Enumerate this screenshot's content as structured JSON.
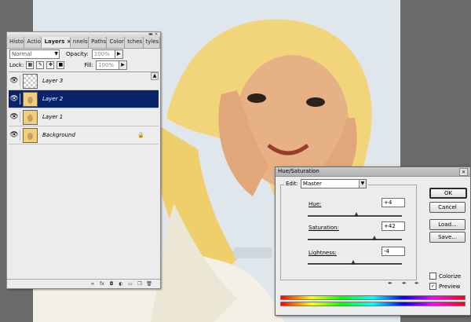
{
  "layers_panel": {
    "tabs": [
      "Histo",
      "Actio",
      "Layers",
      "nnels",
      "Paths",
      "Color",
      "tches",
      "tyles"
    ],
    "blend_mode": "Normal",
    "opacity_label": "Opacity:",
    "opacity_value": "100%",
    "lock_label": "Lock:",
    "fill_label": "Fill:",
    "fill_value": "100%",
    "layers": [
      {
        "name": "Layer 3",
        "selected": false
      },
      {
        "name": "Layer 2",
        "selected": true
      },
      {
        "name": "Layer 1",
        "selected": false
      },
      {
        "name": "Background",
        "selected": false
      }
    ]
  },
  "hue_dialog": {
    "title": "Hue/Saturation",
    "edit_label": "Edit:",
    "edit_value": "Master",
    "hue_label": "Hue:",
    "hue_value": "+4",
    "saturation_label": "Saturation:",
    "saturation_value": "+42",
    "lightness_label": "Lightness:",
    "lightness_value": "-4",
    "ok_label": "OK",
    "cancel_label": "Cancel",
    "load_label": "Load...",
    "save_label": "Save...",
    "colorize_label": "Colorize",
    "preview_label": "Preview",
    "colorize_checked": false,
    "preview_checked": true
  }
}
